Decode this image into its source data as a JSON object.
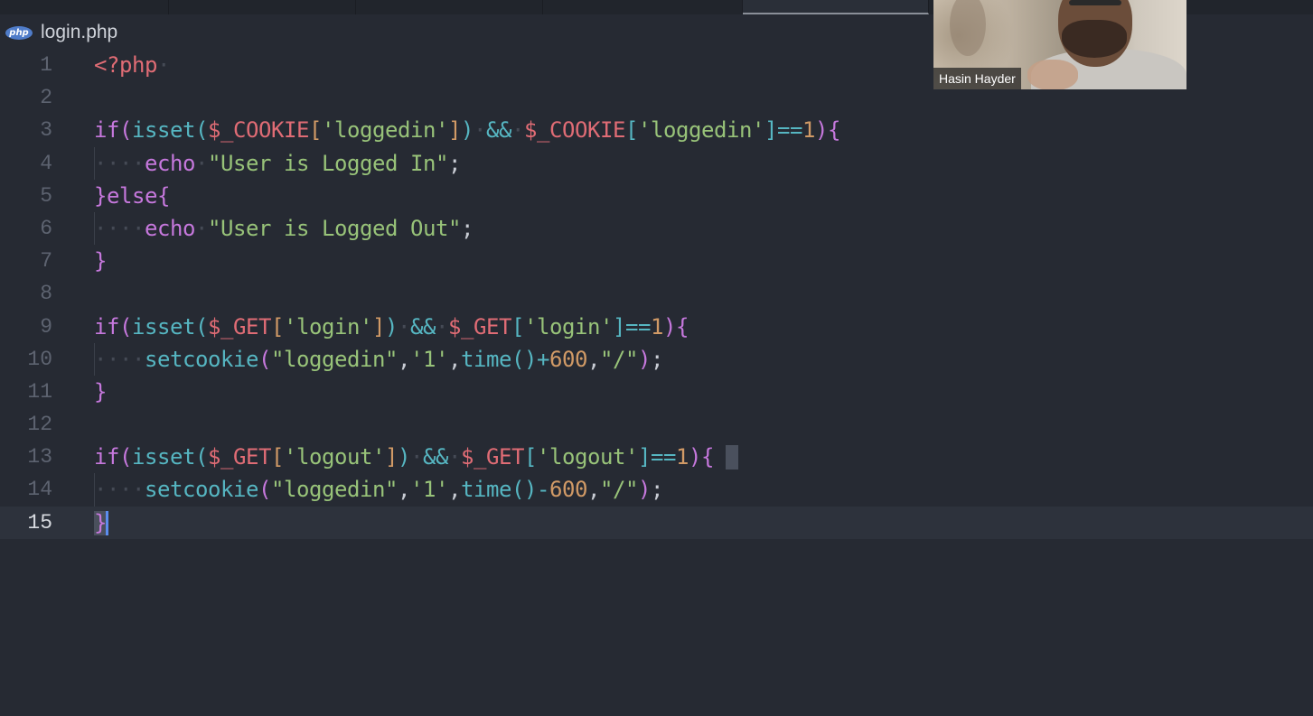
{
  "breadcrumb": {
    "icon": "php-file-icon",
    "icon_label": "php",
    "filename": "login.php"
  },
  "video": {
    "participant_name": "Hasin Hayder"
  },
  "editor": {
    "language": "php",
    "current_line": 15,
    "lines": [
      {
        "number": "1",
        "text": "<?php "
      },
      {
        "number": "2",
        "text": ""
      },
      {
        "number": "3",
        "text": "if(isset($_COOKIE['loggedin']) && $_COOKIE['loggedin']==1){"
      },
      {
        "number": "4",
        "text": "    echo \"User is Logged In\";"
      },
      {
        "number": "5",
        "text": "}else{"
      },
      {
        "number": "6",
        "text": "    echo \"User is Logged Out\";"
      },
      {
        "number": "7",
        "text": "}"
      },
      {
        "number": "8",
        "text": ""
      },
      {
        "number": "9",
        "text": "if(isset($_GET['login']) && $_GET['login']==1){"
      },
      {
        "number": "10",
        "text": "    setcookie(\"loggedin\",'1',time()+600,\"/\");"
      },
      {
        "number": "11",
        "text": "}"
      },
      {
        "number": "12",
        "text": ""
      },
      {
        "number": "13",
        "text": "if(isset($_GET['logout']) && $_GET['logout']==1){"
      },
      {
        "number": "14",
        "text": "    setcookie(\"loggedin\",'1',time()-600,\"/\");"
      },
      {
        "number": "15",
        "text": "}"
      }
    ]
  },
  "colors": {
    "background": "#262a33",
    "tag": "#e06c75",
    "keyword": "#c678dd",
    "function": "#56b6c2",
    "variable": "#e06c75",
    "string": "#98c379",
    "number": "#d19a66",
    "cursor": "#5b8dee"
  }
}
